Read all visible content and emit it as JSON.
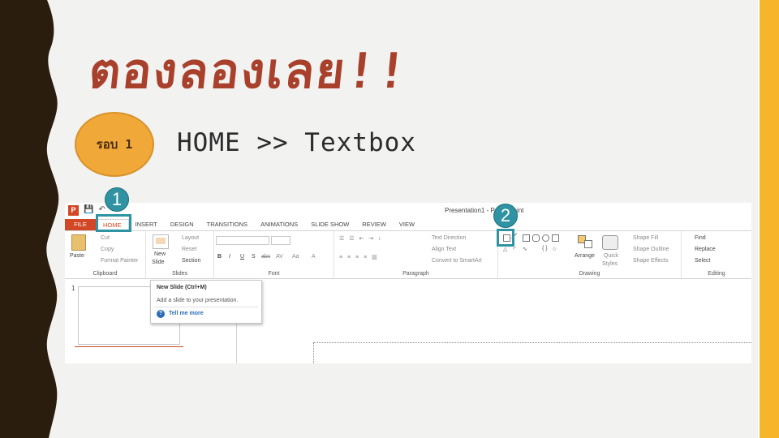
{
  "slide": {
    "title": "ตองลองเลย!!",
    "badge": "รอบ 1",
    "instruction": "HOME >> Textbox"
  },
  "colors": {
    "title": "#a8402b",
    "badge": "#f0a839",
    "accent_bar": "#f7b52c",
    "callout": "#2f93a3",
    "ppt_brand": "#d24726"
  },
  "callouts": {
    "first": "1",
    "second": "2"
  },
  "ppt": {
    "doc_title": "Presentation1 - PowerPoint",
    "tabs": [
      "FILE",
      "HOME",
      "INSERT",
      "DESIGN",
      "TRANSITIONS",
      "ANIMATIONS",
      "SLIDE SHOW",
      "REVIEW",
      "VIEW"
    ],
    "clipboard": {
      "paste": "Paste",
      "cut": "Cut",
      "copy": "Copy",
      "format_painter": "Format Painter",
      "label": "Clipboard"
    },
    "slides": {
      "new_slide": "New",
      "new_slide2": "Slide",
      "layout": "Layout",
      "reset": "Reset",
      "section": "Section",
      "label": "Slides"
    },
    "font": {
      "label": "Font",
      "bold": "B",
      "italic": "I",
      "underline": "U",
      "shadow": "S",
      "strike": "abc",
      "spacing": "AV",
      "case": "Aa",
      "color": "A"
    },
    "paragraph": {
      "text_direction": "Text Direction",
      "align_text": "Align Text",
      "smartart": "Convert to SmartArt",
      "label": "Paragraph"
    },
    "drawing": {
      "arrange": "Arrange",
      "quick": "Quick",
      "styles": "Styles",
      "fill": "Shape Fill",
      "outline": "Shape Outline",
      "effects": "Shape Effects",
      "label": "Drawing"
    },
    "editing": {
      "find": "Find",
      "replace": "Replace",
      "select": "Select",
      "label": "Editing"
    },
    "thumbnail_number": "1",
    "tooltip": {
      "title": "New Slide (Ctrl+M)",
      "desc": "Add a slide to your presentation.",
      "link": "Tell me more"
    }
  }
}
